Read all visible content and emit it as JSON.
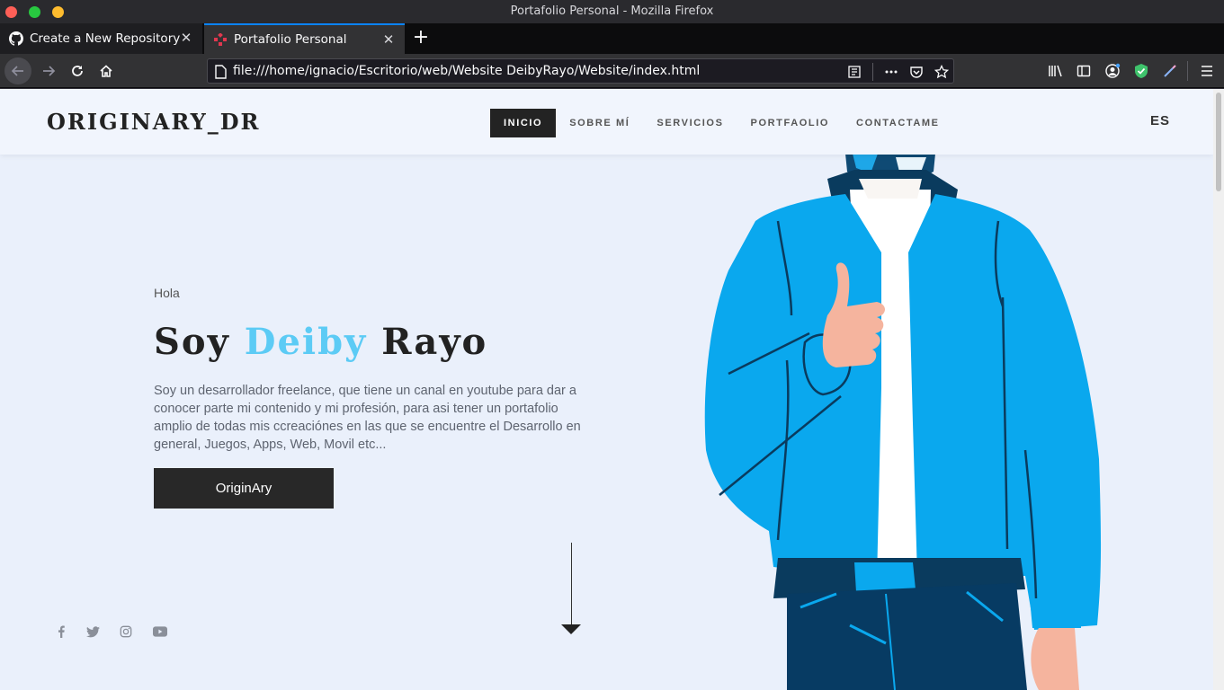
{
  "window": {
    "title": "Portafolio Personal - Mozilla Firefox",
    "colors": {
      "close": "#fe5f57",
      "minimize": "#28c840",
      "maximize": "#febc2e"
    }
  },
  "tabs": [
    {
      "label": "Create a New Repository",
      "icon": "github-icon"
    },
    {
      "label": "Portafolio Personal",
      "icon": "site-favicon-icon"
    }
  ],
  "toolbar": {
    "url": "file:///home/ignacio/Escritorio/web/Website DeibyRayo/Website/index.html"
  },
  "site": {
    "logo": "ORIGINARY_DR",
    "menu": [
      "INICIO",
      "SOBRE MÍ",
      "SERVICIOS",
      "PORTFAOLIO",
      "CONTACTAME"
    ],
    "active_menu": "INICIO",
    "language": "ES"
  },
  "hero": {
    "greeting": "Hola",
    "title_prefix": "Soy",
    "title_accent": "Deiby",
    "title_suffix": "Rayo",
    "description": "Soy un desarrollador freelance, que tiene un canal en youtube para dar a conocer parte mi contenido y mi profesión, para asi tener un portafolio amplio de todas mis ccreaciónes en las que se encuentre el Desarrollo en general, Juegos, Apps, Web, Movil etc...",
    "button": "OriginAry",
    "accent_color": "#5ccbf5"
  },
  "social": [
    "facebook-icon",
    "twitter-icon",
    "instagram-icon",
    "youtube-icon"
  ]
}
